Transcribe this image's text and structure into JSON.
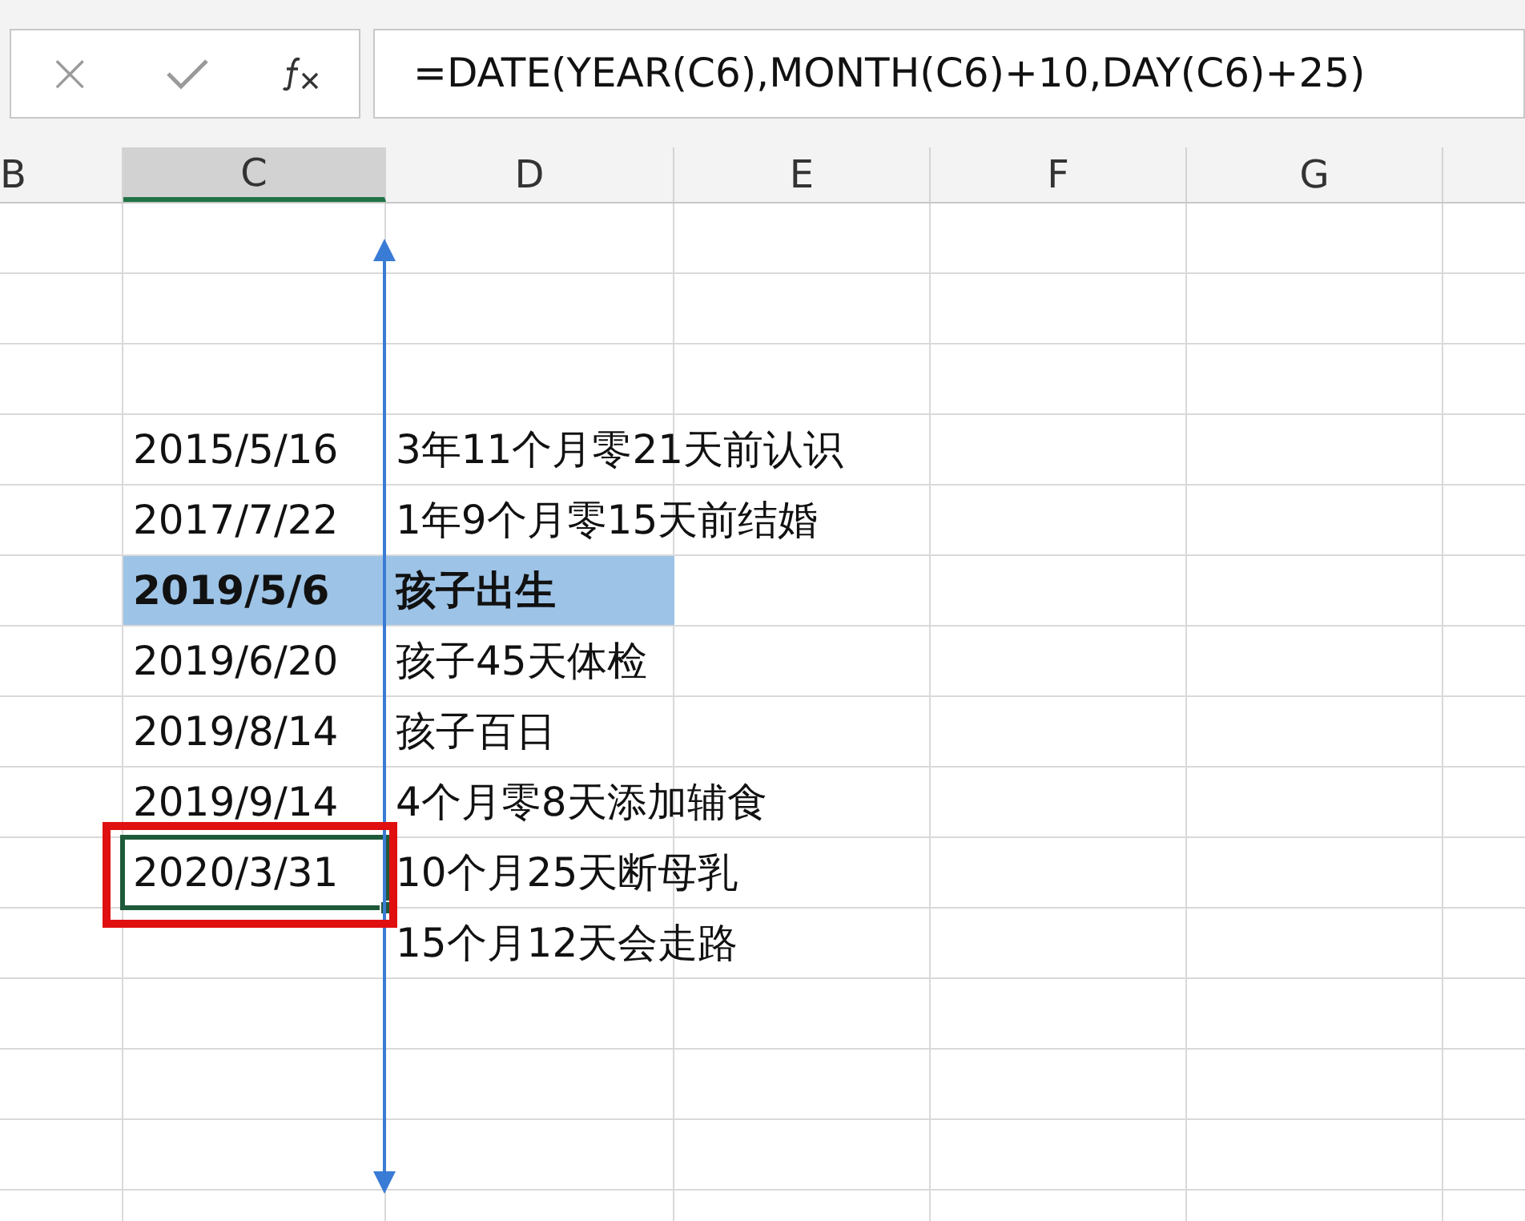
{
  "formula_bar": {
    "cancel_icon": "×",
    "formula": "=DATE(YEAR(C6),MONTH(C6)+10,DAY(C6)+25)"
  },
  "columns": [
    {
      "label": "B",
      "selected": false
    },
    {
      "label": "C",
      "selected": true
    },
    {
      "label": "D",
      "selected": false
    },
    {
      "label": "E",
      "selected": false
    },
    {
      "label": "F",
      "selected": false
    },
    {
      "label": "G",
      "selected": false
    }
  ],
  "rows": [
    {
      "date": "2015/5/16",
      "note": "3年11个月零21天前认识",
      "highlighted": false,
      "selected": false
    },
    {
      "date": "2017/7/22",
      "note": "1年9个月零15天前结婚",
      "highlighted": false,
      "selected": false
    },
    {
      "date": "2019/5/6",
      "note": "孩子出生",
      "highlighted": true,
      "selected": false
    },
    {
      "date": "2019/6/20",
      "note": "孩子45天体检",
      "highlighted": false,
      "selected": false
    },
    {
      "date": "2019/8/14",
      "note": "孩子百日",
      "highlighted": false,
      "selected": false
    },
    {
      "date": "2019/9/14",
      "note": "4个月零8天添加辅食",
      "highlighted": false,
      "selected": false
    },
    {
      "date": "2020/3/31",
      "note": "10个月25天断母乳",
      "highlighted": false,
      "selected": true
    },
    {
      "note": "15个月12天会走路",
      "highlighted": false,
      "selected": false
    }
  ]
}
